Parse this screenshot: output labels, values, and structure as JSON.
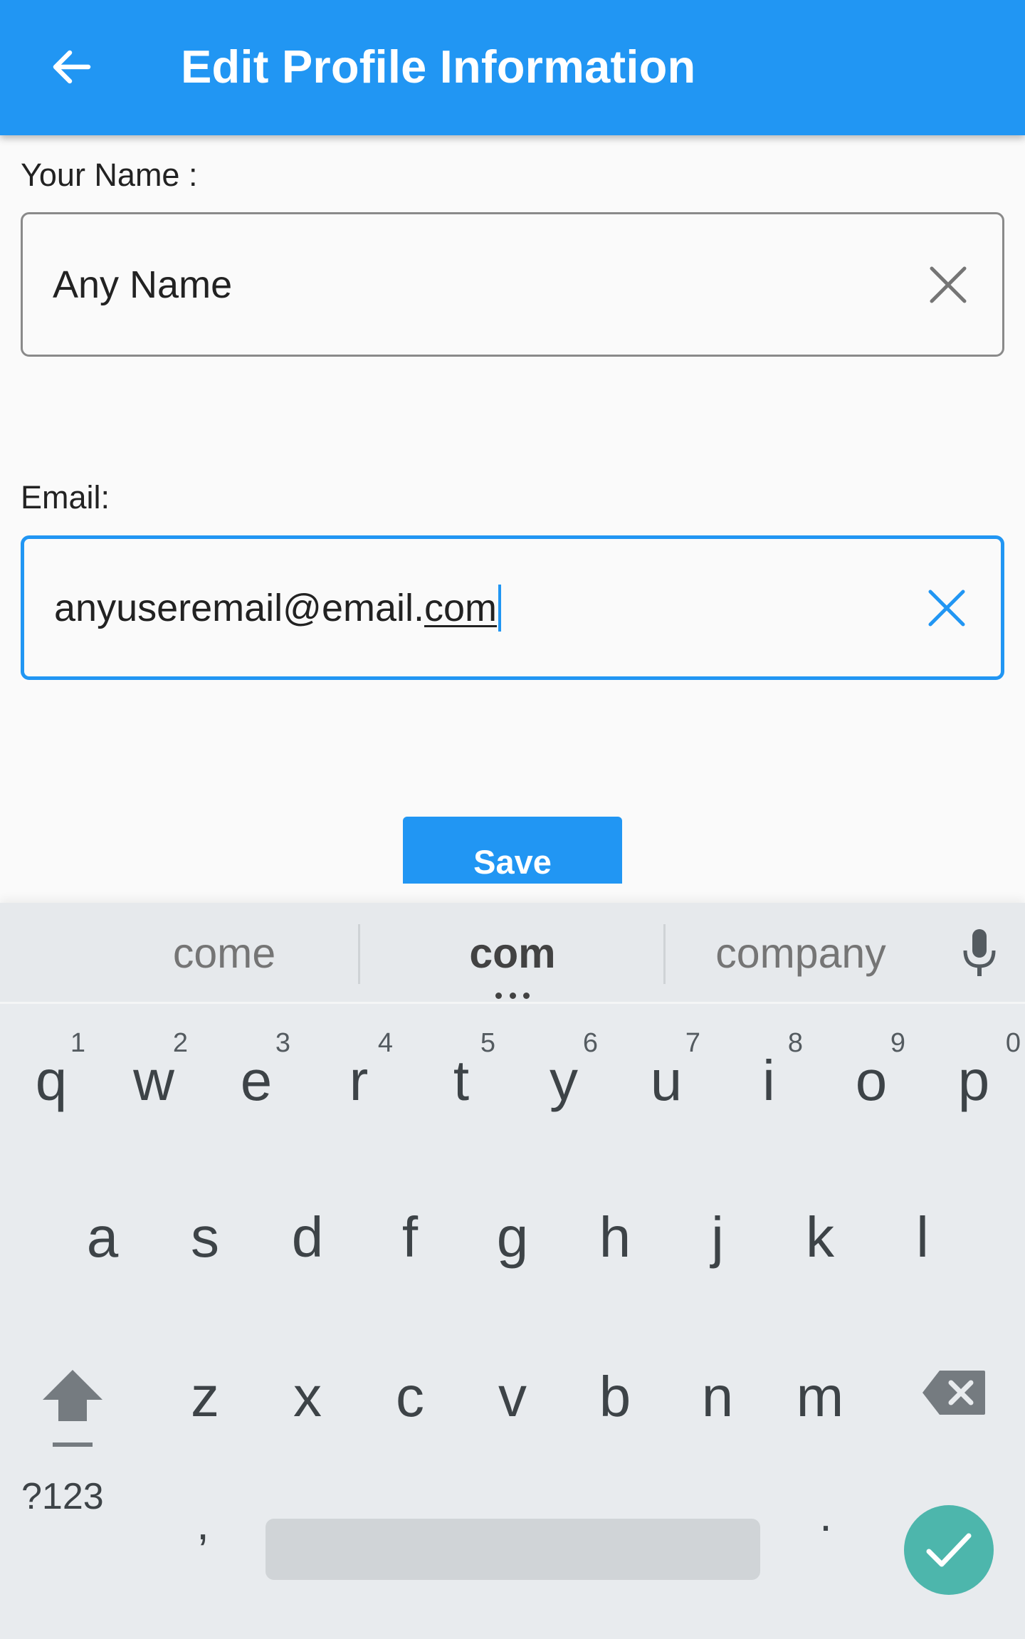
{
  "app_bar": {
    "title": "Edit Profile Information",
    "back_icon": "arrow-left-icon",
    "background": "#2196f3"
  },
  "form": {
    "name": {
      "label": "Your Name :",
      "value": "Any Name",
      "clear_icon": "close-icon"
    },
    "email": {
      "label": "Email:",
      "value_prefix": "anyuseremail@email.",
      "value_composing": "com",
      "clear_icon": "close-icon",
      "focused": true
    },
    "save_label": "Save"
  },
  "keyboard": {
    "suggestions": [
      "come",
      "com",
      "company"
    ],
    "mic_icon": "microphone-icon",
    "row1": [
      {
        "key": "q",
        "hint": "1"
      },
      {
        "key": "w",
        "hint": "2"
      },
      {
        "key": "e",
        "hint": "3"
      },
      {
        "key": "r",
        "hint": "4"
      },
      {
        "key": "t",
        "hint": "5"
      },
      {
        "key": "y",
        "hint": "6"
      },
      {
        "key": "u",
        "hint": "7"
      },
      {
        "key": "i",
        "hint": "8"
      },
      {
        "key": "o",
        "hint": "9"
      },
      {
        "key": "p",
        "hint": "0"
      }
    ],
    "row2": [
      "a",
      "s",
      "d",
      "f",
      "g",
      "h",
      "j",
      "k",
      "l"
    ],
    "row3": [
      "z",
      "x",
      "c",
      "v",
      "b",
      "n",
      "m"
    ],
    "shift_icon": "shift-arrow-icon",
    "backspace_icon": "backspace-icon",
    "symbols_label": "?123",
    "comma_label": ",",
    "period_label": ".",
    "done_icon": "checkmark-icon",
    "accent": "#4db6ac"
  }
}
